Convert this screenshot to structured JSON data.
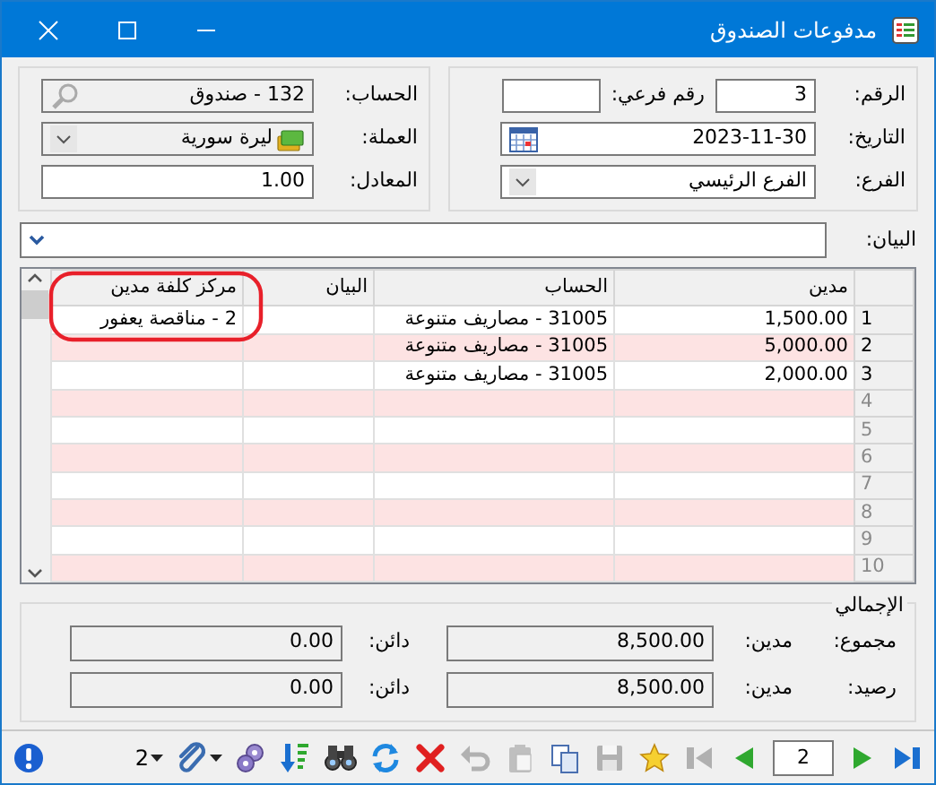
{
  "window": {
    "title": "مدفوعات الصندوق"
  },
  "header": {
    "number": {
      "label": "الرقم:",
      "value": "3"
    },
    "sub_number": {
      "label": "رقم فرعي:"
    },
    "date": {
      "label": "التاريخ:",
      "value": "2023-11-30"
    },
    "branch": {
      "label": "الفرع:",
      "value": "الفرع الرئيسي"
    },
    "account": {
      "label": "الحساب:",
      "value": "132 - صندوق"
    },
    "currency": {
      "label": "العملة:",
      "value": "ليرة سورية"
    },
    "rate": {
      "label": "المعادل:",
      "value": "1.00"
    }
  },
  "statement": {
    "label": "البيان:"
  },
  "table": {
    "columns": [
      "مدين",
      "الحساب",
      "البيان",
      "مركز كلفة مدين"
    ],
    "rows": [
      {
        "number": "1",
        "debit": "1,500.00",
        "account": "31005 - مصاريف متنوعة",
        "cost_center": "2 - مناقصة يعفور"
      },
      {
        "number": "2",
        "debit": "5,000.00",
        "account": "31005 - مصاريف متنوعة"
      },
      {
        "number": "3",
        "debit": "2,000.00",
        "account": "31005 - مصاريف متنوعة"
      },
      {
        "number": "4"
      },
      {
        "number": "5"
      },
      {
        "number": "6"
      },
      {
        "number": "7"
      },
      {
        "number": "8"
      },
      {
        "number": "9"
      },
      {
        "number": "10"
      }
    ]
  },
  "annotation": {
    "kind": "ellipse"
  },
  "totals": {
    "title": "الإجمالي",
    "rows": [
      {
        "label": "مجموع:",
        "debit_label": "مدين:",
        "debit": "8,500.00",
        "credit_label": "دائن:",
        "credit": "0.00"
      },
      {
        "label": "رصيد:",
        "debit_label": "مدين:",
        "debit": "8,500.00",
        "credit_label": "دائن:",
        "credit": "0.00"
      }
    ]
  },
  "toolbar": {
    "items": [
      {
        "kind": "last",
        "disabled": false
      },
      {
        "kind": "next",
        "disabled": false
      },
      {
        "kind": "page",
        "value": "2"
      },
      {
        "kind": "prev",
        "disabled": false
      },
      {
        "kind": "first",
        "disabled": true
      },
      {
        "kind": "favorite",
        "disabled": false
      },
      {
        "kind": "save",
        "disabled": true
      },
      {
        "kind": "copy",
        "disabled": false
      },
      {
        "kind": "paste",
        "disabled": true
      },
      {
        "kind": "undo",
        "disabled": true
      },
      {
        "kind": "delete",
        "disabled": false
      },
      {
        "kind": "refresh",
        "disabled": false
      },
      {
        "kind": "find",
        "disabled": false
      },
      {
        "kind": "sort",
        "disabled": false
      },
      {
        "kind": "options",
        "disabled": false
      },
      {
        "kind": "dropdown",
        "disabled": false
      },
      {
        "kind": "attach",
        "disabled": false
      },
      {
        "kind": "dropdown",
        "disabled": false
      },
      {
        "kind": "count",
        "value": "2"
      },
      {
        "kind": "spacer"
      },
      {
        "kind": "info",
        "disabled": false
      }
    ]
  }
}
